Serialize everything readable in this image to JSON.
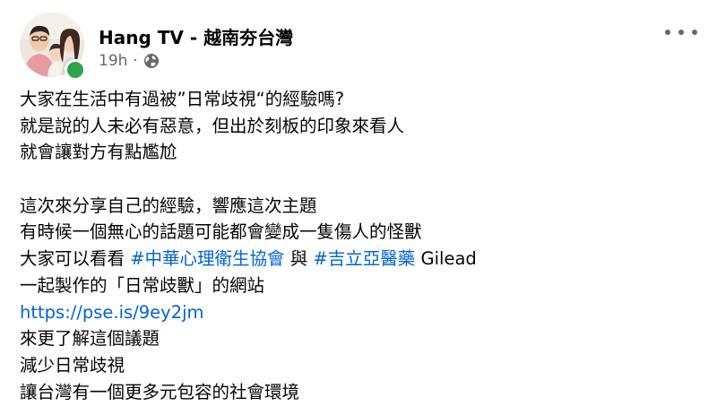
{
  "post": {
    "author": "Hang TV - 越南夯台灣",
    "timestamp": "19h",
    "separator": "·",
    "privacy_icon": "globe-icon",
    "menu_icon": "more-horizontal-icon",
    "status_color": "#31a24c"
  },
  "body": {
    "line1": "大家在生活中有過被”日常歧視“的經驗嗎?",
    "line2": "就是說的人未必有惡意，但出於刻板的印象來看人",
    "line3": "就會讓對方有點尷尬",
    "line4": "這次來分享自己的經驗，響應這次主題",
    "line5": "有時候一個無心的話題可能都會變成一隻傷人的怪獸",
    "line6_prefix": "大家可以看看 ",
    "hashtag1": "#中華心理衛生協會",
    "line6_mid": " 與 ",
    "hashtag2": "#吉立亞醫藥",
    "line6_suffix": " Gilead",
    "line7": "一起製作的「日常歧獸」的網站",
    "link": "https://pse.is/9ey2jm",
    "line8": "來更了解這個議題",
    "line9": "減少日常歧視",
    "line10": "讓台灣有一個更多元包容的社會環境"
  },
  "colors": {
    "link": "#0064d1",
    "text": "#050505",
    "meta": "#65676b"
  }
}
